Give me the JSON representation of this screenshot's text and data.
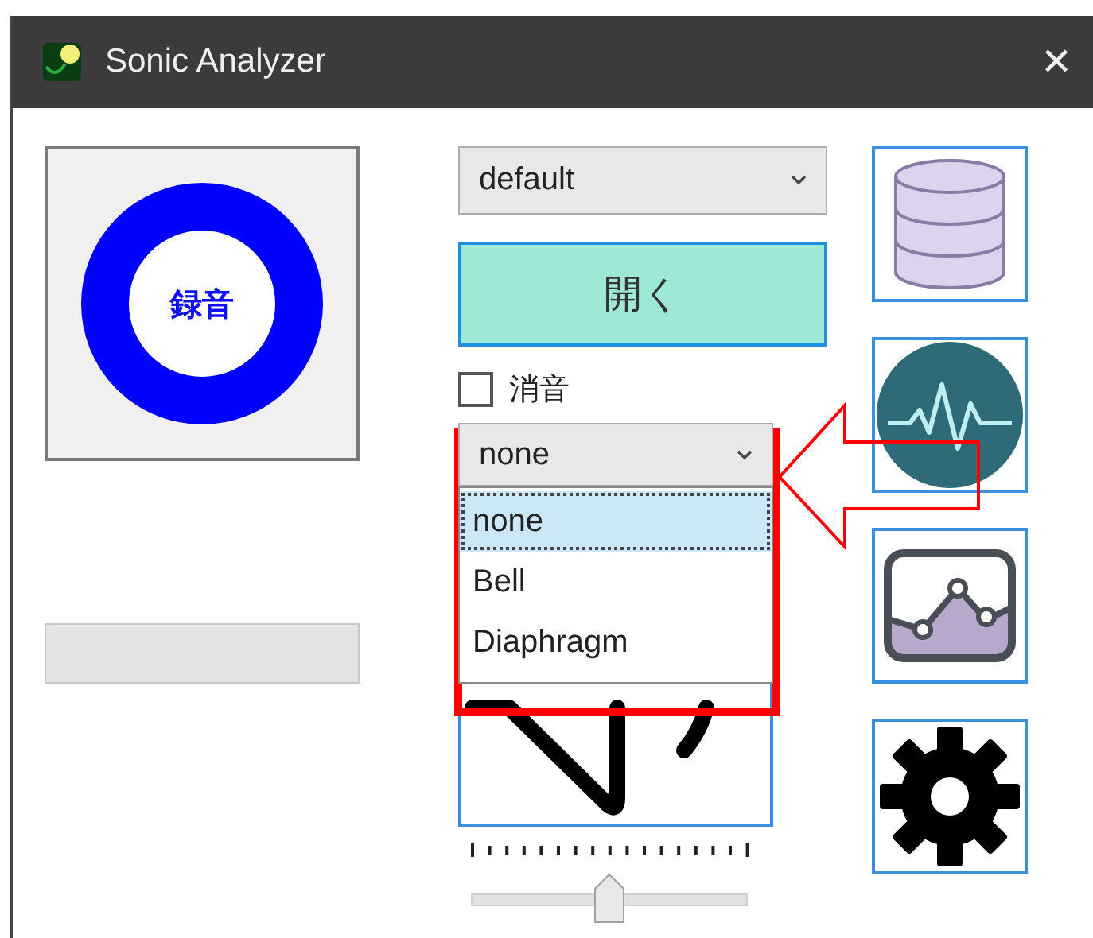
{
  "window": {
    "title": "Sonic Analyzer",
    "close": "✕"
  },
  "record_button": {
    "label": "録音"
  },
  "progress_bar": {
    "level": 0
  },
  "profile_select": {
    "value": "default"
  },
  "open_button": {
    "label": "開く"
  },
  "mute_checkbox": {
    "label": "消音",
    "checked": false
  },
  "mode_select": {
    "value": "none",
    "expanded": true,
    "options": [
      {
        "label": "none",
        "selected": true
      },
      {
        "label": "Bell",
        "selected": false
      },
      {
        "label": "Diaphragm",
        "selected": false
      }
    ]
  },
  "volume_slider": {
    "level": 0.5
  },
  "tool_buttons": [
    {
      "kind": "database"
    },
    {
      "kind": "waveform"
    },
    {
      "kind": "chart"
    },
    {
      "kind": "settings"
    }
  ]
}
